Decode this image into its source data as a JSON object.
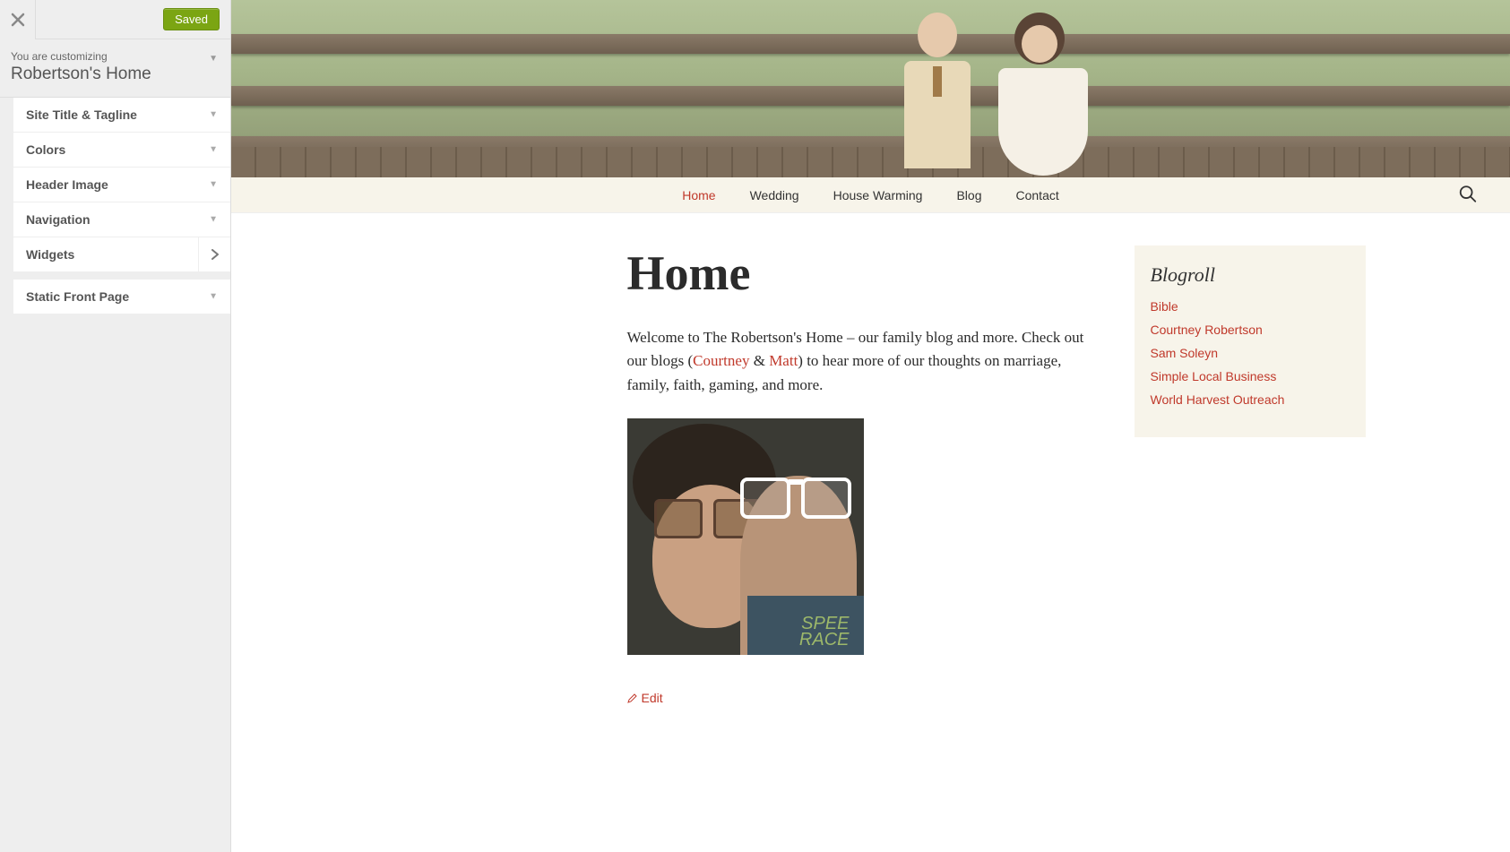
{
  "customizer": {
    "close_icon": "close",
    "saved_label": "Saved",
    "sub_label": "You are customizing",
    "site_name": "Robertson's Home",
    "sections": [
      {
        "label": "Site Title & Tagline",
        "type": "dropdown"
      },
      {
        "label": "Colors",
        "type": "dropdown"
      },
      {
        "label": "Header Image",
        "type": "dropdown"
      },
      {
        "label": "Navigation",
        "type": "dropdown"
      },
      {
        "label": "Widgets",
        "type": "panel"
      },
      {
        "label": "Static Front Page",
        "type": "dropdown"
      }
    ]
  },
  "nav": {
    "items": [
      {
        "label": "Home",
        "active": true
      },
      {
        "label": "Wedding",
        "active": false
      },
      {
        "label": "House Warming",
        "active": false
      },
      {
        "label": "Blog",
        "active": false
      },
      {
        "label": "Contact",
        "active": false
      }
    ]
  },
  "page": {
    "title": "Home",
    "intro_pre": "Welcome to The Robertson's Home – our family blog and more. Check out our blogs (",
    "link1": "Courtney",
    "amp": " & ",
    "link2": "Matt",
    "intro_post": ") to hear more of our thoughts on marriage, family, faith, gaming, and more.",
    "shirt_line1": "SPEE",
    "shirt_line2": "RACE",
    "edit_label": "Edit"
  },
  "blogroll": {
    "title": "Blogroll",
    "links": [
      "Bible",
      "Courtney Robertson",
      "Sam Soleyn",
      "Simple Local Business",
      "World Harvest Outreach"
    ]
  },
  "colors": {
    "accent": "#c0392b",
    "save_btn": "#7ba513",
    "widget_bg": "#f7f4ea"
  }
}
